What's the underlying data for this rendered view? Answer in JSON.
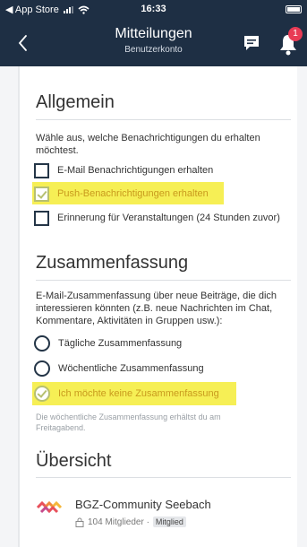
{
  "status_bar": {
    "back_app": "◀ App Store",
    "time": "16:33"
  },
  "nav": {
    "title": "Mitteilungen",
    "subtitle": "Benutzerkonto",
    "notification_count": "1"
  },
  "general": {
    "heading": "Allgemein",
    "description": "Wähle aus, welche Benachrichtigungen du erhalten möchtest.",
    "options": [
      {
        "label": "E-Mail Benachrichtigungen erhalten",
        "checked": false
      },
      {
        "label": "Push-Benachrichtigungen erhalten",
        "checked": true
      },
      {
        "label": "Erinnerung für Veranstaltungen (24 Stunden zuvor)",
        "checked": false
      }
    ]
  },
  "summary": {
    "heading": "Zusammenfassung",
    "description": "E-Mail-Zusammenfassung über neue Beiträge, die dich interessieren könnten (z.B. neue Nachrichten im Chat, Kommentare, Aktivitäten in Gruppen usw.):",
    "options": [
      {
        "label": "Tägliche Zusammenfassung",
        "selected": false
      },
      {
        "label": "Wöchentliche Zusammenfassung",
        "selected": false
      },
      {
        "label": "Ich möchte keine Zusammenfassung",
        "selected": true
      }
    ],
    "hint": "Die wöchentliche Zusammenfassung erhältst du am Freitagabend."
  },
  "overview": {
    "heading": "Übersicht",
    "community": {
      "name": "BGZ-Community Seebach",
      "members": "104 Mitglieder ·",
      "role": "Mitglied"
    }
  },
  "colors": {
    "header_bg": "#1e2f44",
    "highlight": "#f6ef55",
    "checked_color": "#b7c070",
    "badge": "#e83b55"
  }
}
